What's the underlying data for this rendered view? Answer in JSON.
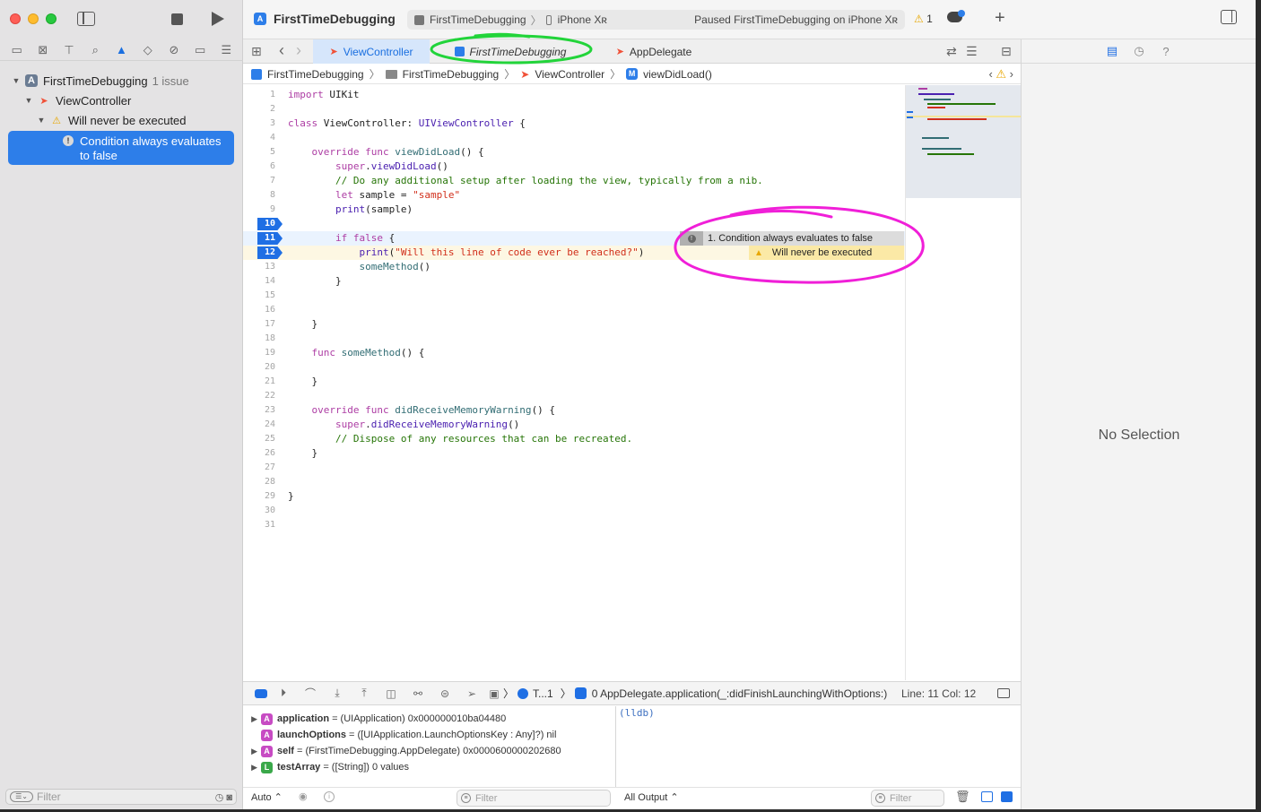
{
  "window": {
    "title": "FirstTimeDebugging",
    "scheme": "FirstTimeDebugging",
    "destination": "iPhone Xʀ",
    "status": "Paused FirstTimeDebugging on iPhone Xʀ",
    "warning_count": "1"
  },
  "navigator": {
    "project": "FirstTimeDebugging",
    "issue_count": "1 issue",
    "file": "ViewController",
    "warning": "Will never be executed",
    "selected_issue": "Condition always evaluates to false",
    "filter_placeholder": "Filter"
  },
  "tabs": [
    {
      "label": "ViewController"
    },
    {
      "label": "FirstTimeDebugging"
    },
    {
      "label": "AppDelegate"
    }
  ],
  "jumpbar": [
    "FirstTimeDebugging",
    "FirstTimeDebugging",
    "ViewController",
    "viewDidLoad()"
  ],
  "code": {
    "line_numbers": [
      "1",
      "2",
      "3",
      "4",
      "5",
      "6",
      "7",
      "8",
      "9",
      "10",
      "11",
      "12",
      "13",
      "14",
      "15",
      "16",
      "17",
      "18",
      "19",
      "20",
      "21",
      "22",
      "23",
      "24",
      "25",
      "26",
      "27",
      "28",
      "29",
      "30",
      "31"
    ],
    "breakpoint_lines": [
      "10",
      "11",
      "12"
    ],
    "issue_error": "1. Condition always evaluates to false",
    "issue_warning": "Will never be executed"
  },
  "debug": {
    "thread": "T...1",
    "frame": "0 AppDelegate.application(_:didFinishLaunchingWithOptions:)",
    "position": "Line: 11  Col: 12"
  },
  "variables": [
    {
      "badge": "A",
      "name": "application",
      "value": "= (UIApplication) 0x000000010ba04480",
      "expandable": true
    },
    {
      "badge": "A",
      "name": "launchOptions",
      "value": "= ([UIApplication.LaunchOptionsKey : Any]?) nil",
      "expandable": false
    },
    {
      "badge": "A",
      "name": "self",
      "value": "= (FirstTimeDebugging.AppDelegate) 0x0000600000202680",
      "expandable": true
    },
    {
      "badge": "L",
      "name": "testArray",
      "value": "= ([String]) 0 values",
      "expandable": true
    }
  ],
  "console": {
    "prompt": "(lldb)"
  },
  "bottom": {
    "auto": "Auto ⌃",
    "vars_filter": "Filter",
    "output": "All Output ⌃",
    "console_filter": "Filter"
  },
  "inspector": {
    "empty": "No Selection"
  },
  "colors": {
    "accent": "#1f6fe4",
    "annotation_green": "#22d43a",
    "annotation_magenta": "#f01fd8",
    "warning": "#e8a700"
  }
}
